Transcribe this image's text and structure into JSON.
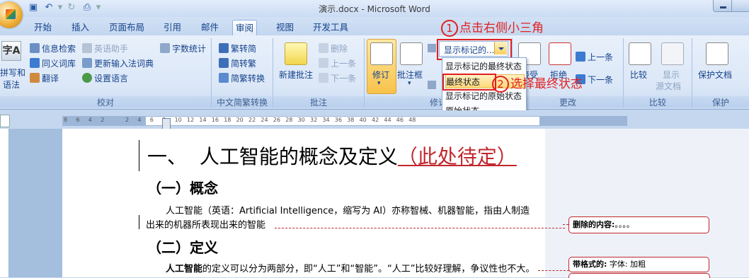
{
  "window": {
    "title": "演示.docx - Microsoft Word"
  },
  "tabs": [
    "开始",
    "插入",
    "页面布局",
    "引用",
    "邮件",
    "审阅",
    "视图",
    "开发工具"
  ],
  "active_tab": "审阅",
  "ribbon": {
    "proofing": {
      "label": "校对",
      "spelling_line1": "拼写和",
      "spelling_line2": "语法",
      "research": "信息检索",
      "thesaurus": "同义词库",
      "translate": "翻译",
      "english_assistant": "英语助手",
      "update_ime": "更新输入法词典",
      "set_language": "设置语言",
      "word_count": "字数统计"
    },
    "chinese_conversion": {
      "label": "中文简繁转换",
      "to_simplified": "繁转简",
      "to_traditional": "简转繁",
      "conversion": "简繁转换"
    },
    "comments": {
      "label": "批注",
      "new_comment": "新建批注",
      "delete": "删除",
      "previous": "上一条",
      "next": "下一条"
    },
    "tracking": {
      "label": "修订",
      "track_changes": "修订",
      "balloons": "批注框",
      "display_select": "显示标记的...",
      "menu_items": [
        "显示标记的最终状态",
        "最终状态",
        "显示标记的原始状态",
        "原始状态"
      ],
      "selected_item": "最终状态"
    },
    "changes": {
      "label": "更改",
      "accept": "接受",
      "reject": "拒绝",
      "previous": "上一条",
      "next": "下一条"
    },
    "compare": {
      "label": "比较",
      "compare": "比较",
      "show_source_line1": "显示",
      "show_source_line2": "源文档"
    },
    "protect": {
      "label": "保护",
      "protect_document": "保护文档"
    }
  },
  "annotations": {
    "step1_num": "1",
    "step1_text": "点击右侧小三角",
    "step2_num": "2",
    "step2_text": "选择最终状态"
  },
  "ruler_ticks": [
    "8",
    "6",
    "4",
    "2",
    "",
    "2",
    "4",
    "6",
    "8",
    "10",
    "12",
    "14",
    "16",
    "18",
    "20",
    "22",
    "24",
    "26",
    "28",
    "30",
    "32",
    "34",
    "36",
    "38",
    "40",
    "42",
    "44",
    "46",
    "48"
  ],
  "document": {
    "heading1_prefix": "一、",
    "heading1_main": "人工智能的概念及定义",
    "heading1_inserted": "（此处待定）",
    "heading2_a": "（一）概念",
    "para1_line1": "人工智能（英语：Artificial Intelligence，缩写为 AI）亦称智械、机器智能，指由人制造",
    "para1_line2": "出来的机器所表现出来的智能",
    "heading2_b": "（二）定义",
    "para2_bold": "人工智能",
    "para2_rest": "的定义可以分为两部分，即“人工”和“智能”。“人工”比较好理解，争议性也不大。"
  },
  "balloons": {
    "deleted_label": "删除的内容:",
    "deleted_value": "。。。。",
    "format_label": "带格式的:",
    "format_value": "字体: 加粗"
  },
  "colors": {
    "annotation_red": "#e02020",
    "revision_red": "#c0272d",
    "ribbon_blue": "#15428b"
  }
}
